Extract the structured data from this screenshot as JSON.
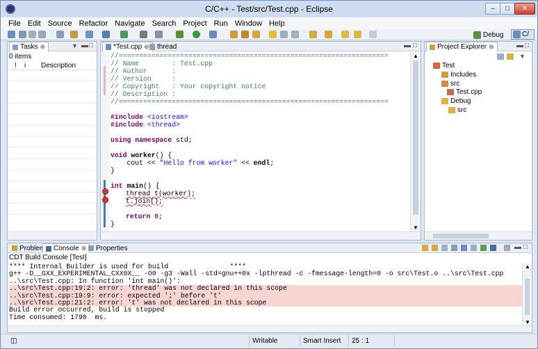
{
  "window": {
    "title": "C/C++ - Test/src/Test.cpp - Eclipse"
  },
  "menu": [
    "File",
    "Edit",
    "Source",
    "Refactor",
    "Navigate",
    "Search",
    "Project",
    "Run",
    "Window",
    "Help"
  ],
  "perspectives": {
    "debug": "Debug",
    "cpp": "C/"
  },
  "tasks": {
    "tab": "Tasks",
    "count": "0 items",
    "col_pri": "!",
    "col_type": "i",
    "col_desc": "Description"
  },
  "editor": {
    "tabs": [
      {
        "label": "*Test.cpp",
        "active": true
      },
      {
        "label": "thread",
        "active": false
      }
    ],
    "code": {
      "l1": "//==================================================================",
      "l2": "// Name        : Test.cpp",
      "l3": "// Author      :",
      "l4": "// Version     :",
      "l5": "// Copyright   : Your copyright notice",
      "l6": "// Description :",
      "l7": "//==================================================================",
      "inc1_kw": "#include",
      "inc1_file": "<iostream>",
      "inc2_kw": "#include",
      "inc2_file": "<thread>",
      "using_kw": "using namespace",
      "using_rest": " std;",
      "void_kw": "void",
      "worker_fn": "worker",
      "worker_rest": "() {",
      "cout_pre": "    cout << ",
      "cout_str": "\"Hello from worker\"",
      "cout_mid": " << ",
      "cout_endl": "endl",
      "cout_end": ";",
      "close1": "}",
      "int_kw": "int",
      "main_fn": "main",
      "main_rest": "() {",
      "thread_line": "thread t(worker);",
      "join_line": "t.join();",
      "return_kw": "return",
      "return_rest": " 0;",
      "close2": "}"
    }
  },
  "explorer": {
    "tab": "Project Explorer",
    "items": [
      "Test",
      "Includes",
      "src",
      "Test.cpp",
      "Debug",
      "src"
    ]
  },
  "console": {
    "tabs": {
      "problems": "Problems",
      "console": "Console",
      "properties": "Properties"
    },
    "title": "CDT Build Console [Test]",
    "lines": [
      "**** Internal Builder is used for build               ****",
      "g++ -D__GXX_EXPERIMENTAL_CXX0X__ -O0 -g3 -Wall -std=gnu++0x -lpthread -c -fmessage-length=0 -o src\\Test.o ..\\src\\Test.cpp",
      "..\\src\\Test.cpp: In function 'int main()':",
      "..\\src\\Test.cpp:19:2: error: 'thread' was not declared in this scope",
      "..\\src\\Test.cpp:19:9: error: expected ';' before 't'",
      "..\\src\\Test.cpp:21:2: error: 't' was not declared in this scope",
      "Build error occurred, build is stopped",
      "Time consumed: 1790  ms."
    ]
  },
  "status": {
    "writable": "Writable",
    "insert": "Smart Insert",
    "position": "25 : 1"
  }
}
